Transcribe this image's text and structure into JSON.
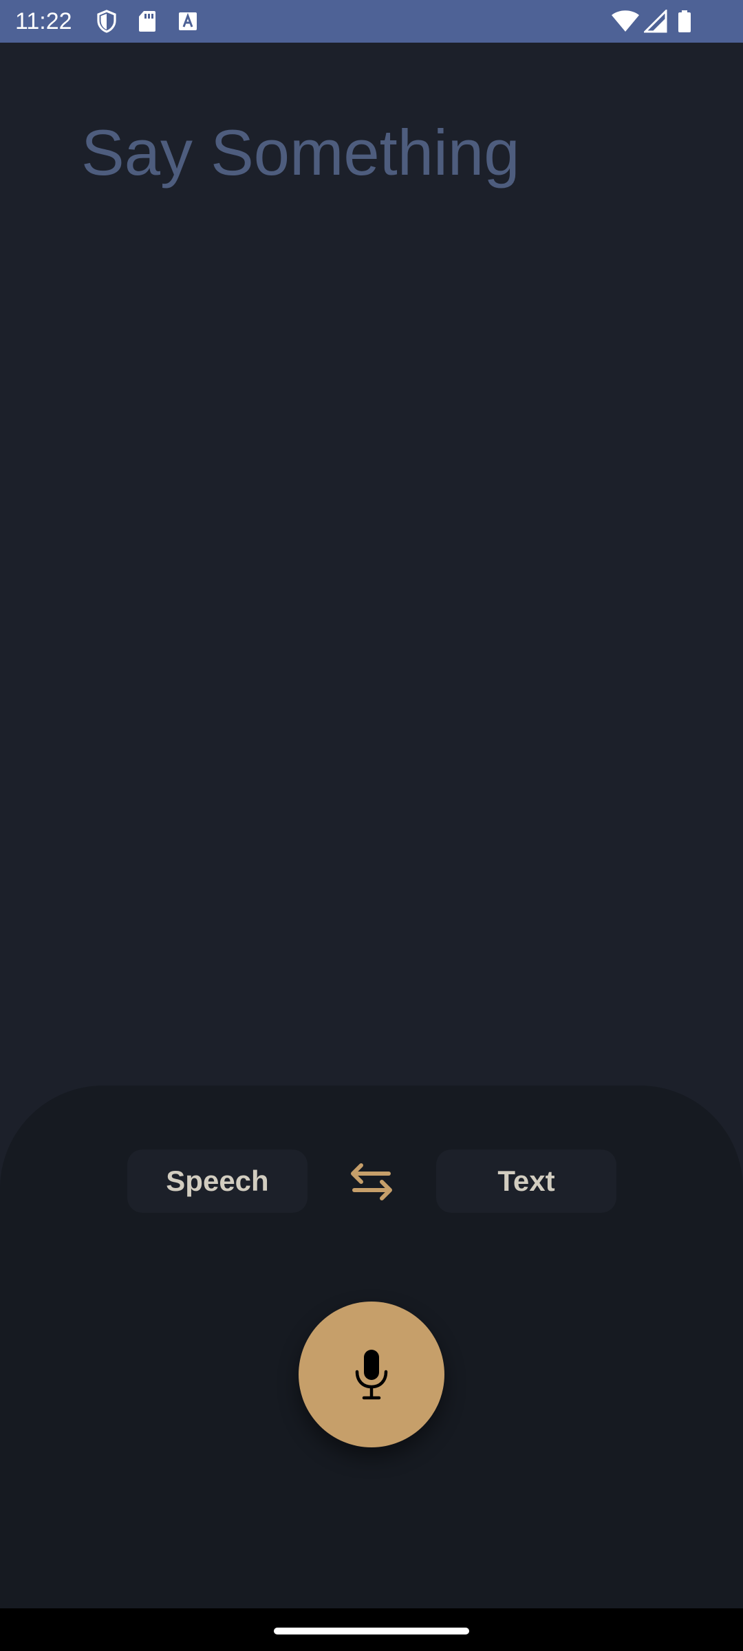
{
  "status_bar": {
    "time": "11:22",
    "left_icons": [
      "shield-icon",
      "sd-card-icon",
      "keyboard-a-icon"
    ],
    "right_icons": [
      "wifi-icon",
      "signal-icon",
      "battery-icon"
    ],
    "background": "#4e6296"
  },
  "main": {
    "prompt": "Say Something",
    "prompt_color": "#4e5d7e"
  },
  "controls": {
    "source_language": "Speech",
    "target_language": "Text",
    "swap_icon": "swap-arrows-icon",
    "mic_icon": "microphone-icon",
    "accent_color": "#c69f6a"
  },
  "colors": {
    "background": "#1c202a",
    "panel": "#161a21",
    "chip": "#1c2029",
    "chip_text": "#d2cdc0"
  }
}
